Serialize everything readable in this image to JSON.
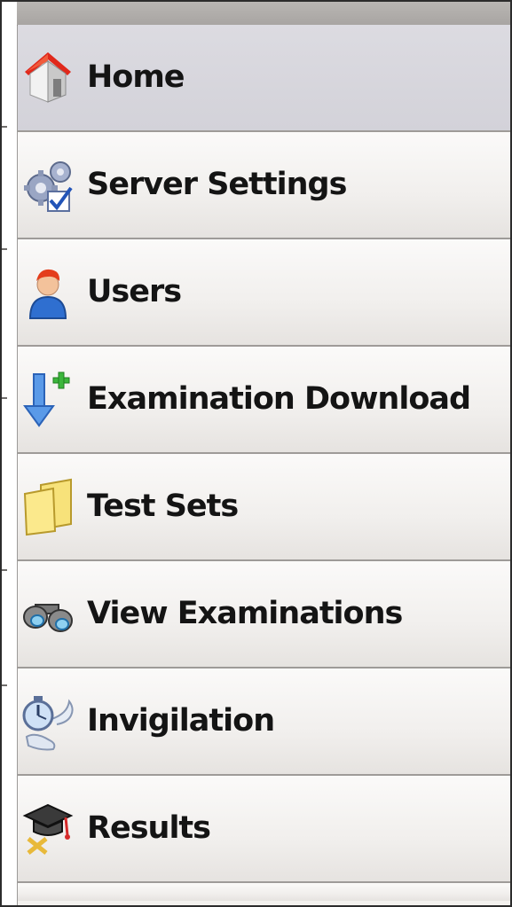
{
  "nav": {
    "items": [
      {
        "label": "Home",
        "icon": "home-icon",
        "active": true
      },
      {
        "label": "Server Settings",
        "icon": "gears-check-icon"
      },
      {
        "label": "Users",
        "icon": "user-icon"
      },
      {
        "label": "Examination Download",
        "icon": "download-plus-icon"
      },
      {
        "label": "Test Sets",
        "icon": "folder-icon"
      },
      {
        "label": "View Examinations",
        "icon": "binoculars-icon"
      },
      {
        "label": "Invigilation",
        "icon": "stopwatch-scroll-icon"
      },
      {
        "label": "Results",
        "icon": "graduation-cap-icon"
      }
    ]
  },
  "colors": {
    "active_bg": "#d8d7de",
    "item_bg": "#f2f0ee",
    "text": "#141414"
  }
}
